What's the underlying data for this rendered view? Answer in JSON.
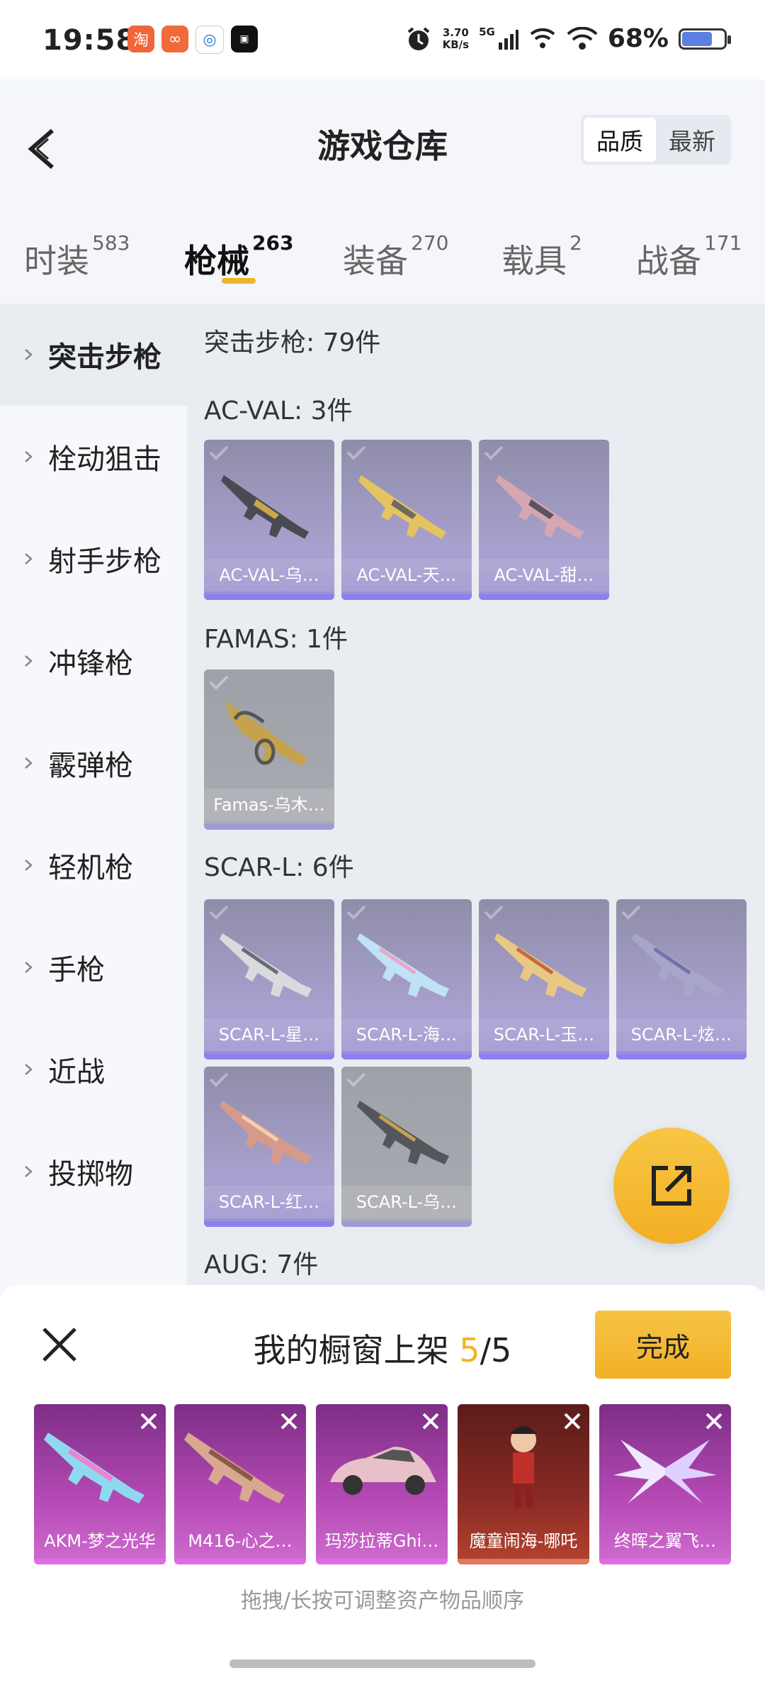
{
  "status": {
    "time": "19:58",
    "speed_value": "3.70",
    "speed_unit": "KB/s",
    "network": "5G",
    "battery": "68%",
    "battery_level": 0.68
  },
  "header": {
    "title": "游戏仓库",
    "sort_options": [
      "品质",
      "最新"
    ],
    "sort_selected": "品质"
  },
  "tabs": [
    {
      "label": "时装",
      "count": "583"
    },
    {
      "label": "枪械",
      "count": "263"
    },
    {
      "label": "装备",
      "count": "270"
    },
    {
      "label": "载具",
      "count": "2"
    },
    {
      "label": "战备",
      "count": "171"
    }
  ],
  "sidebar": [
    "突击步枪",
    "栓动狙击",
    "射手步枪",
    "冲锋枪",
    "霰弹枪",
    "轻机枪",
    "手枪",
    "近战",
    "投掷物"
  ],
  "content": {
    "category_title": "突击步枪: 79件",
    "groups": [
      {
        "title": "AC-VAL: 3件",
        "items": [
          "AC-VAL-乌…",
          "AC-VAL-天…",
          "AC-VAL-甜…"
        ]
      },
      {
        "title": "FAMAS: 1件",
        "items": [
          "Famas-乌木…"
        ]
      },
      {
        "title": "SCAR-L: 6件",
        "items": [
          "SCAR-L-星…",
          "SCAR-L-海…",
          "SCAR-L-玉…",
          "SCAR-L-炫…",
          "SCAR-L-红…",
          "SCAR-L-乌…"
        ]
      },
      {
        "title": "AUG: 7件",
        "items": []
      }
    ]
  },
  "showcase": {
    "title_prefix": "我的橱窗上架",
    "count": "5",
    "total": "/5",
    "done_label": "完成",
    "items": [
      "AKM-梦之光华",
      "M416-心之…",
      "玛莎拉蒂Ghi…",
      "魔童闹海-哪吒",
      "终晖之翼飞…"
    ],
    "hint": "拖拽/长按可调整资产物品顺序"
  }
}
